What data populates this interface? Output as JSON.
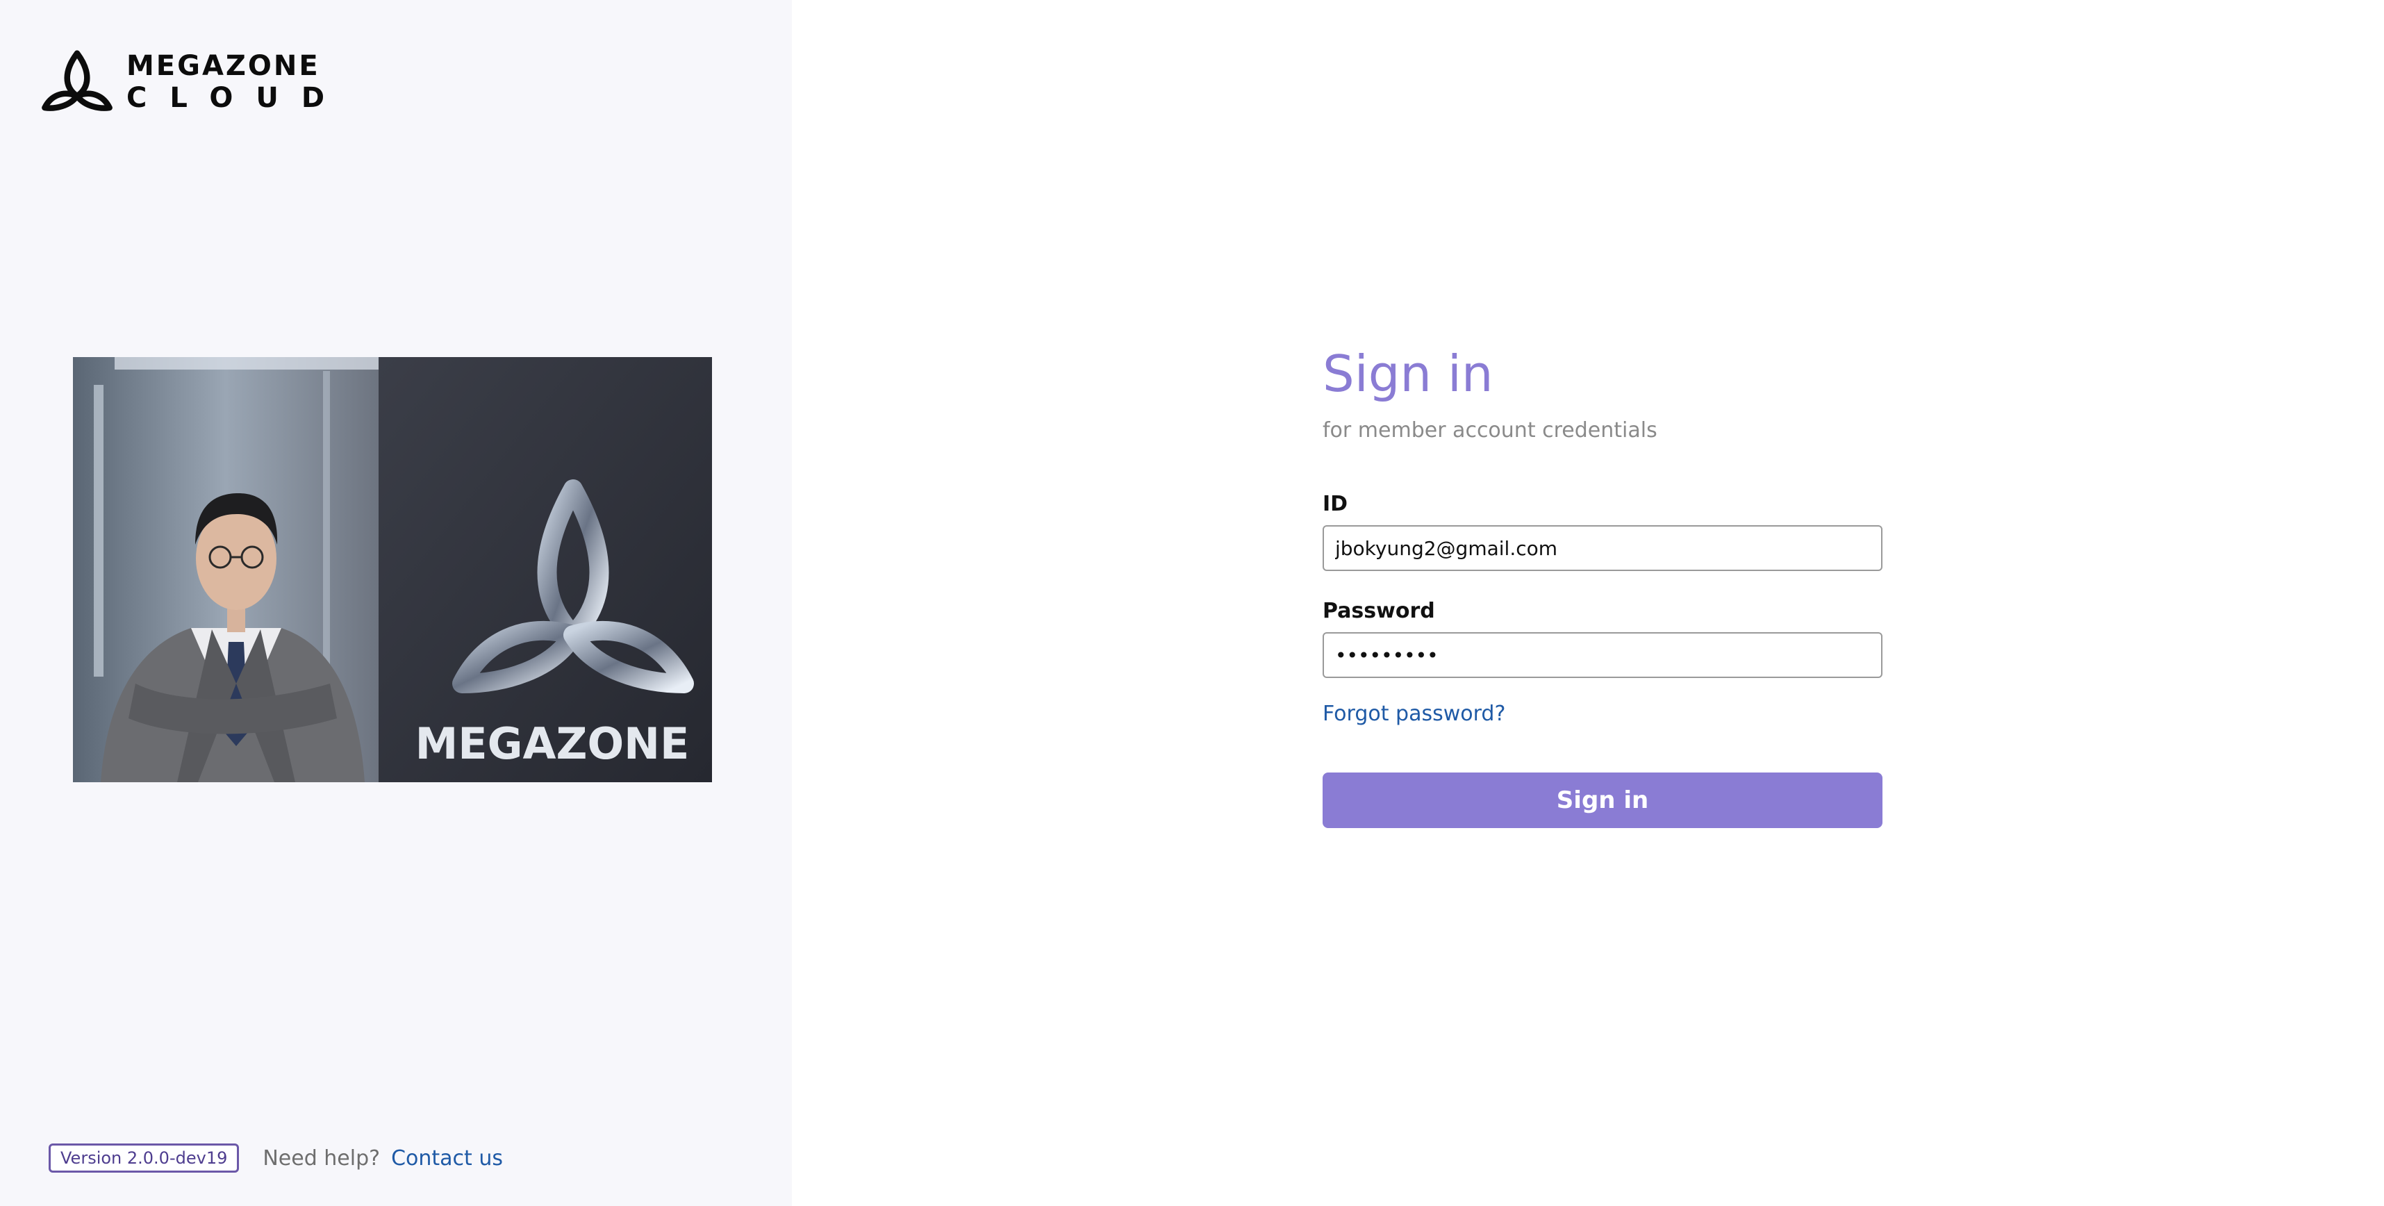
{
  "brand": {
    "logo_line1": "MEGAZONE",
    "logo_line2": "CLOUD",
    "hero_sign_text": "MEGAZONE",
    "accent_color": "#8a7cd4",
    "link_color": "#1f5aa6",
    "logo_icon": "megazone-trinity-knot-icon"
  },
  "footer": {
    "version": "Version 2.0.0-dev19",
    "help_text": "Need help?",
    "contact_label": "Contact us"
  },
  "signin": {
    "title": "Sign in",
    "subtitle": "for member account credentials",
    "id_label": "ID",
    "id_value": "jbokyung2@gmail.com",
    "password_label": "Password",
    "password_value": "passwordx",
    "forgot_label": "Forgot password?",
    "button_label": "Sign in"
  }
}
